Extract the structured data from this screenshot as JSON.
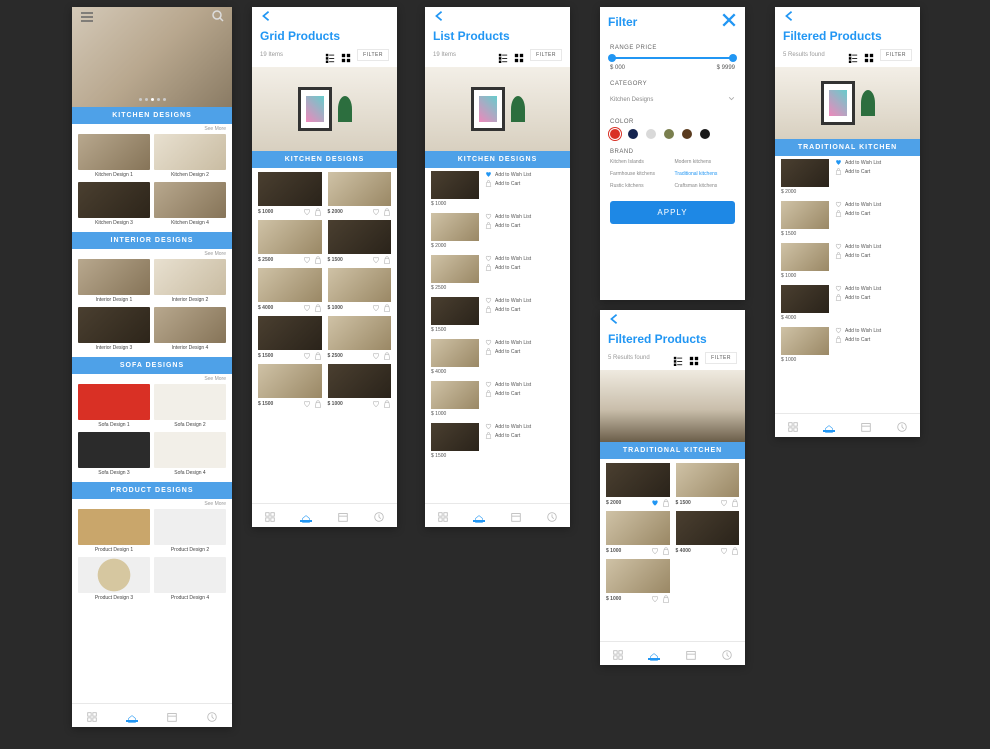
{
  "screens": {
    "home": {
      "banners": [
        "KITCHEN DESIGNS",
        "INTERIOR DESIGNS",
        "SOFA DESIGNS",
        "PRODUCT DESIGNS"
      ],
      "see_more": "See More",
      "kitchen": [
        "Kitchen Design 1",
        "Kitchen Design 2",
        "Kitchen Design 3",
        "Kitchen Design 4"
      ],
      "interior": [
        "Interior Design 1",
        "Interior Design 2",
        "Interior Design 3",
        "Interior Design 4"
      ],
      "sofa": [
        "Sofa Design 1",
        "Sofa Design 2",
        "Sofa Design 3",
        "Sofa Design 4"
      ],
      "product": [
        "Product Design 1",
        "Product Design 2",
        "Product Design 3",
        "Product Design 4"
      ]
    },
    "grid": {
      "title": "Grid Products",
      "count": "19 Items",
      "filter": "FILTER",
      "banner": "KITCHEN DESIGNS",
      "prices": [
        "$ 1000",
        "$ 2000",
        "$ 2500",
        "$ 1500",
        "$ 4000",
        "$ 1000",
        "$ 1500",
        "$ 2500",
        "$ 1500",
        "$ 1000"
      ]
    },
    "list": {
      "title": "List Products",
      "count": "19 Items",
      "filter": "FILTER",
      "banner": "KITCHEN DESIGNS",
      "wish": "Add to Wish List",
      "cart": "Add to Cart",
      "prices": [
        "$ 1000",
        "$ 2000",
        "$ 2500",
        "$ 1500",
        "$ 4000",
        "$ 1000",
        "$ 1500"
      ]
    },
    "filter": {
      "title": "Filter",
      "range": "RANGE PRICE",
      "price_min": "$ 000",
      "price_max": "$ 9999",
      "category": "CATEGORY",
      "category_value": "Kitchen Designs",
      "color": "COLOR",
      "colors": [
        "#d93025",
        "#14234f",
        "#d9d9d9",
        "#7a7f4e",
        "#5a3b1f",
        "#1a1a1a"
      ],
      "brand": "BRAND",
      "brands": [
        "Kitchen Islands",
        "Modern kitchens",
        "Farmhouse kitchens",
        "Traditional kitchens",
        "Rustic kitchens",
        "Craftsman kitchens"
      ],
      "apply": "APPLY"
    },
    "filtered_grid": {
      "title": "Filtered Products",
      "count": "5 Results found",
      "filter": "FILTER",
      "banner": "TRADITIONAL KITCHEN",
      "prices": [
        "$ 2000",
        "$ 1500",
        "$ 1000",
        "$ 4000",
        "$ 1000"
      ]
    },
    "filtered_list": {
      "title": "Filtered Products",
      "count": "5 Results found",
      "filter": "FILTER",
      "banner": "TRADITIONAL KITCHEN",
      "wish": "Add to Wish List",
      "cart": "Add to Cart",
      "prices": [
        "$ 2000",
        "$ 1500",
        "$ 1000",
        "$ 4000",
        "$ 1000"
      ]
    }
  }
}
